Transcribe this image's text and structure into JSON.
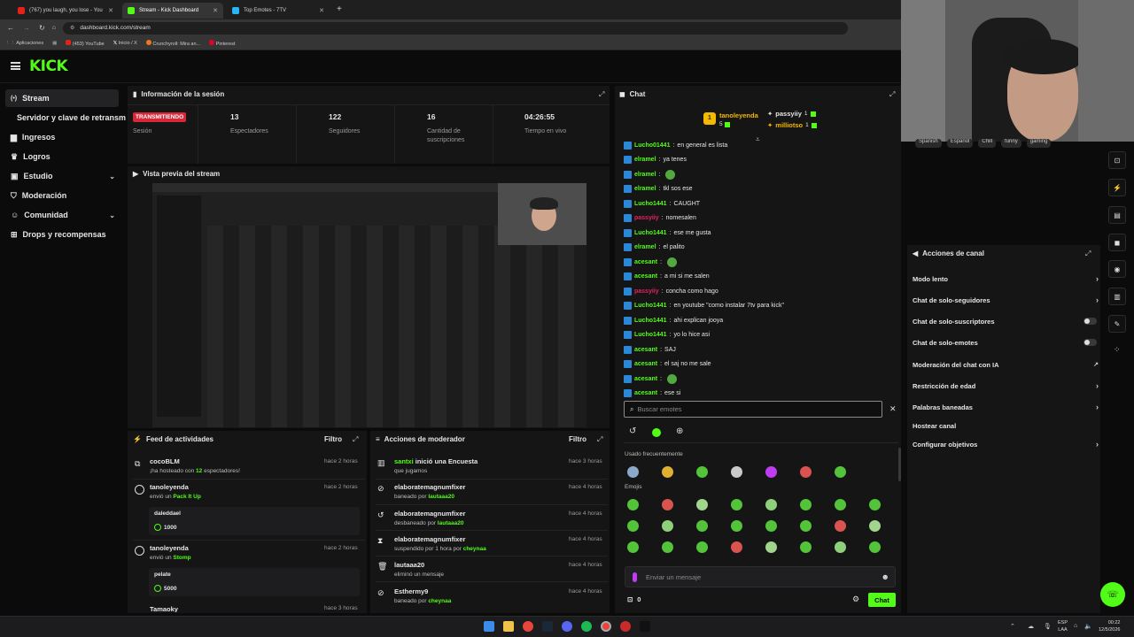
{
  "browser": {
    "tabs": [
      {
        "title": "(767) you laugh, you lose - You"
      },
      {
        "title": "Stream - Kick Dashboard"
      },
      {
        "title": "Top Emotes - 7TV"
      }
    ],
    "url": "dashboard.kick.com/stream",
    "bookmarks": [
      "Aplicaciones",
      "(453) YouTube",
      "Inicio / X",
      "Crunchyroll: Mira an...",
      "Pinterest"
    ]
  },
  "brand": {
    "logo_text": "KICK",
    "accent": "#53fc18"
  },
  "sidebar": {
    "items": [
      {
        "label": "Stream"
      },
      {
        "label": "Servidor y clave de retransmisión"
      },
      {
        "label": "Ingresos"
      },
      {
        "label": "Logros"
      },
      {
        "label": "Estudio"
      },
      {
        "label": "Moderación"
      },
      {
        "label": "Comunidad"
      },
      {
        "label": "Drops y recompensas"
      }
    ]
  },
  "session": {
    "title": "Información de la sesión",
    "status": "TRANSMITIENDO",
    "status_label": "Sesión",
    "viewers": "13",
    "viewers_label": "Espectadores",
    "followers": "122",
    "followers_label": "Seguidores",
    "subs": "16",
    "subs_label": "Cantidad de suscripciones",
    "time": "04:26:55",
    "time_label": "Tiempo en vivo"
  },
  "preview": {
    "title": "Vista previa del stream"
  },
  "activity": {
    "title": "Feed de actividades",
    "filter": "Filtro",
    "items": [
      {
        "name": "cocoBLM",
        "pre": "¡ha hosteado con ",
        "hl": "12",
        "post": " espectadores!",
        "time": "hace 2 horas"
      },
      {
        "name": "tanoleyenda",
        "pre": "envió un ",
        "hl": "Pack It Up",
        "post": "",
        "time": "hace 2 horas",
        "msg": "daleddael",
        "amount": "1000"
      },
      {
        "name": "tanoleyenda",
        "pre": "envió un ",
        "hl": "Stomp",
        "post": "",
        "time": "hace 2 horas",
        "msg": "pelate",
        "amount": "5000"
      },
      {
        "name": "Tamaoky",
        "time": "hace 3 horas"
      }
    ]
  },
  "modactions": {
    "title": "Acciones de moderador",
    "filter": "Filtro",
    "items": [
      {
        "name": "santxi",
        "rest": " inició una Encuesta",
        "sub": "que jugamos",
        "hl": "",
        "time": "hace 3 horas"
      },
      {
        "name": "elaboratemagnumfixer",
        "sub": "baneado por ",
        "hl": "lautaaa20",
        "time": "hace 4 horas"
      },
      {
        "name": "elaboratemagnumfixer",
        "sub": "desbaneado por ",
        "hl": "lautaaa20",
        "time": "hace 4 horas"
      },
      {
        "name": "elaboratemagnumfixer",
        "sub": "suspendido por 1 hora por ",
        "hl": "cheynaa",
        "time": "hace 4 horas"
      },
      {
        "name": "lautaaa20",
        "sub": "eliminó un mensaje",
        "hl": "",
        "time": "hace 4 horas"
      },
      {
        "name": "Esthermy9",
        "sub": "baneado por ",
        "hl": "cheynaa",
        "time": "hace 4 horas"
      }
    ]
  },
  "chat": {
    "title": "Chat",
    "top": [
      {
        "name": "tanoleyenda",
        "count": "5"
      },
      {
        "name": "passyiiy",
        "count": "1"
      },
      {
        "name": "milliotso",
        "count": "1"
      }
    ],
    "messages": [
      {
        "user": "Lucho01441",
        "text": "en general es lista",
        "color": "#53fc18"
      },
      {
        "user": "elramel",
        "text": "ya tenes",
        "color": "#53fc18"
      },
      {
        "user": "elramel",
        "text": "",
        "color": "#53fc18"
      },
      {
        "user": "elramel",
        "text": "tkl sos ese",
        "color": "#53fc18"
      },
      {
        "user": "Lucho1441",
        "text": "CAUGHT",
        "color": "#53fc18"
      },
      {
        "user": "passyiiy",
        "text": "nomesalen",
        "color": "#e0245e"
      },
      {
        "user": "Lucho1441",
        "text": "ese me gusta",
        "color": "#53fc18"
      },
      {
        "user": "elramel",
        "text": "el palito",
        "color": "#53fc18"
      },
      {
        "user": "acesant",
        "text": "",
        "color": "#53fc18"
      },
      {
        "user": "acesant",
        "text": "a mi si me salen",
        "color": "#53fc18"
      },
      {
        "user": "passyiiy",
        "text": "concha como hago",
        "color": "#e0245e"
      },
      {
        "user": "Lucho1441",
        "text": "en youtube \"como instalar 7tv para kick\"",
        "color": "#53fc18"
      },
      {
        "user": "Lucho1441",
        "text": "ahi explican jooya",
        "color": "#53fc18"
      },
      {
        "user": "Lucho1441",
        "text": "yo lo hice asi",
        "color": "#53fc18"
      },
      {
        "user": "acesant",
        "text": "SAJ",
        "color": "#53fc18"
      },
      {
        "user": "acesant",
        "text": "el saj no me sale",
        "color": "#53fc18"
      },
      {
        "user": "acesant",
        "text": "",
        "color": "#53fc18"
      },
      {
        "user": "acesant",
        "text": "ese si",
        "color": "#53fc18"
      }
    ],
    "emote_search_placeholder": "Buscar emotes",
    "frequent_label": "Usado frecuentemente",
    "emojis_label": "Emojis",
    "input_placeholder": "Enviar un mensaje",
    "points": "0",
    "send_label": "Chat"
  },
  "channel_actions": {
    "title": "Acciones de canal",
    "items": [
      {
        "label": "Modo lento",
        "control": "chevron"
      },
      {
        "label": "Chat de solo-seguidores",
        "control": "chevron"
      },
      {
        "label": "Chat de solo-suscriptores",
        "control": "toggle"
      },
      {
        "label": "Chat de solo-emotes",
        "control": "toggle"
      },
      {
        "label": "Moderación del chat con IA",
        "control": "link"
      },
      {
        "label": "Restricción de edad",
        "control": "chevron"
      },
      {
        "label": "Palabras baneadas",
        "control": "chevron"
      },
      {
        "label": "Hostear canal",
        "control": "none"
      },
      {
        "label": "Configurar objetivos",
        "control": "chevron"
      }
    ]
  },
  "webcam": {
    "tags": [
      "Spanish",
      "Español",
      "Chill",
      "funny",
      "gaming"
    ]
  },
  "taskbar": {
    "lang": "ESP",
    "lang2": "LAA",
    "time": "00:22",
    "date": "12/5/2026"
  }
}
